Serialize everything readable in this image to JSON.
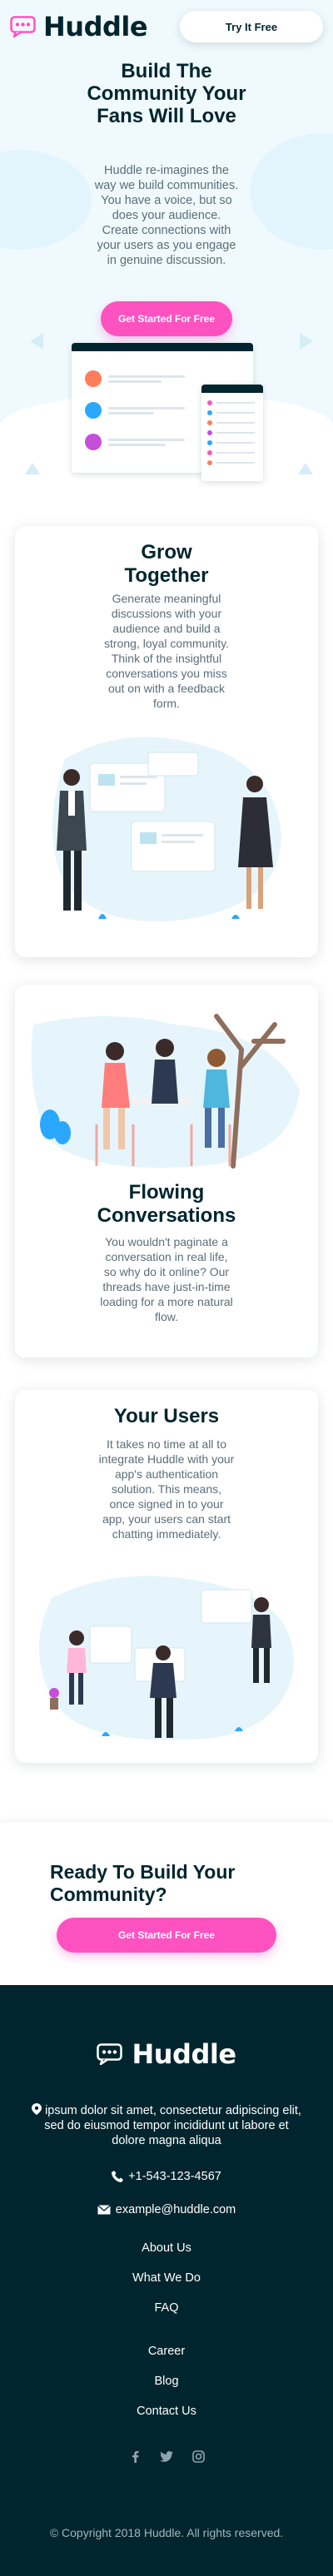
{
  "header": {
    "brand": "Huddle",
    "try_button": "Try It Free"
  },
  "hero": {
    "title": "Build The Community Your Fans Will Love",
    "text": "Huddle re-imagines the way we build communities. You have a voice, but so does your audience. Create connections with your users as you engage in genuine discussion.",
    "cta": "Get Started For Free"
  },
  "features": [
    {
      "title": "Grow Together",
      "text": "Generate meaningful discussions with your audience and build a strong, loyal community. Think of the insightful conversations you miss out on with a feedback form."
    },
    {
      "title": "Flowing Conversations",
      "text": "You wouldn't paginate a conversation in real life, so why do it online? Our threads have just-in-time loading for a more natural flow."
    },
    {
      "title": "Your Users",
      "text": "It takes no time at all to integrate Huddle with your app's authentication solution. This means, once signed in to your app, your users can start chatting immediately."
    }
  ],
  "ready": {
    "title": "Ready To Build Your Community?",
    "cta": "Get Started For Free"
  },
  "footer": {
    "brand": "Huddle",
    "address": "ipsum dolor sit amet, consectetur adipiscing elit, sed do eiusmod tempor incididunt ut labore et dolore magna aliqua",
    "phone": "+1-543-123-4567",
    "email": "example@huddle.com",
    "links_primary": [
      "About Us",
      "What We Do",
      "FAQ"
    ],
    "links_secondary": [
      "Career",
      "Blog",
      "Contact Us"
    ],
    "social": [
      "facebook-icon",
      "twitter-icon",
      "instagram-icon"
    ],
    "copyright": "© Copyright 2018 Huddle. All rights reserved."
  },
  "colors": {
    "pink": "#ff52c1",
    "dark": "#00252e",
    "text_muted": "#5b6e78",
    "hero_bg": "#f0fafe"
  }
}
